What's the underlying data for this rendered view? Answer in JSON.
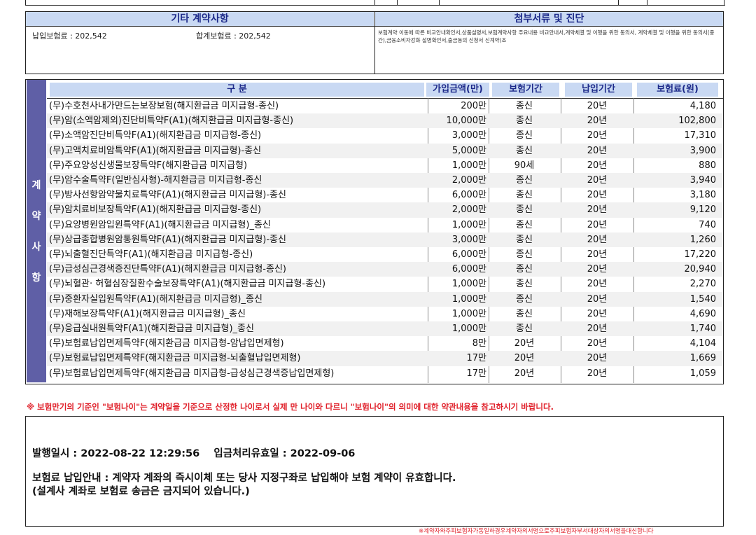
{
  "etc_section": {
    "left_header": "기타 계약사항",
    "right_header": "첨부서류 및 진단",
    "installment_label": "납입보험료 : 202,542",
    "total_label": "합계보험료 : 202,542",
    "docs_text": "보험계약 이동에 따른 비교안내확인서,상품설명서,보험계약사항 주요내용 비교안내서,계약체결 및 이행을 위한 동의서, 계약체결 및 이행을 위한 동의서(중간),금융소비자강화 설명확인서,출금동의 신청서 신계약(조"
  },
  "side_label": [
    "계",
    "약",
    "사",
    "항"
  ],
  "table": {
    "headers": [
      "구 분",
      "가입금액(만)",
      "보험기간",
      "납입기간",
      "보험료(원)"
    ],
    "rows": [
      {
        "name": "(무)수호천사내가만드는보장보험(해지환급금 미지급형-종신)",
        "amount": "200만",
        "period": "종신",
        "pay": "20년",
        "premium": "4,180"
      },
      {
        "name": "(무)암(소액암제외)진단비특약F(A1)(해지환급금 미지급형-종신)",
        "amount": "10,000만",
        "period": "종신",
        "pay": "20년",
        "premium": "102,800"
      },
      {
        "name": "(무)소액암진단비특약F(A1)(해지환급금 미지급형-종신)",
        "amount": "3,000만",
        "period": "종신",
        "pay": "20년",
        "premium": "17,310"
      },
      {
        "name": "(무)고액치료비암특약F(A1)(해지환급금 미지급형)-종신",
        "amount": "5,000만",
        "period": "종신",
        "pay": "20년",
        "premium": "3,900"
      },
      {
        "name": "(무)주요양성신생물보장특약F(해지환급금 미지급형)",
        "amount": "1,000만",
        "period": "90세",
        "pay": "20년",
        "premium": "880"
      },
      {
        "name": "(무)암수술특약F(일반심사형)-해지환급금 미지급형-종신",
        "amount": "2,000만",
        "period": "종신",
        "pay": "20년",
        "premium": "3,940"
      },
      {
        "name": "(무)방사선항암약물치료특약F(A1)(해지환급금 미지급형)-종신",
        "amount": "6,000만",
        "period": "종신",
        "pay": "20년",
        "premium": "3,180"
      },
      {
        "name": "(무)암치료비보장특약F(A1)(해지환급금 미지급형-종신)",
        "amount": "2,000만",
        "period": "종신",
        "pay": "20년",
        "premium": "9,120"
      },
      {
        "name": "(무)요양병원암입원특약F(A1)(해지환급금 미지급형)_종신",
        "amount": "1,000만",
        "period": "종신",
        "pay": "20년",
        "premium": "740"
      },
      {
        "name": "(무)상급종합병원암통원특약F(A1)(해지환급금 미지급형)-종신",
        "amount": "3,000만",
        "period": "종신",
        "pay": "20년",
        "premium": "1,260"
      },
      {
        "name": "(무)뇌출혈진단특약F(A1)(해지환급금 미지급형-종신)",
        "amount": "6,000만",
        "period": "종신",
        "pay": "20년",
        "premium": "17,220"
      },
      {
        "name": "(무)급성심근경색증진단특약F(A1)(해지환급금 미지급형-종신)",
        "amount": "6,000만",
        "period": "종신",
        "pay": "20년",
        "premium": "20,940"
      },
      {
        "name": "(무)뇌혈관· 허혈심장질환수술보장특약F(A1)(해지환급금 미지급형-종신)",
        "amount": "1,000만",
        "period": "종신",
        "pay": "20년",
        "premium": "2,270"
      },
      {
        "name": "(무)중환자실입원특약F(A1)(해지환급금 미지급형)_종신",
        "amount": "1,000만",
        "period": "종신",
        "pay": "20년",
        "premium": "1,540"
      },
      {
        "name": "(무)재해보장특약F(A1)(해지환급금 미지급형)_종신",
        "amount": "1,000만",
        "period": "종신",
        "pay": "20년",
        "premium": "4,690"
      },
      {
        "name": "(무)응급실내원특약F(A1)(해지환급금 미지급형)_종신",
        "amount": "1,000만",
        "period": "종신",
        "pay": "20년",
        "premium": "1,740"
      },
      {
        "name": "(무)보험료납입면제특약F(해지환급금 미지급형-암납입면제형)",
        "amount": "8만",
        "period": "20년",
        "pay": "20년",
        "premium": "4,104"
      },
      {
        "name": "(무)보험료납입면제특약F(해지환급금 미지급형-뇌출혈납입면제형)",
        "amount": "17만",
        "period": "20년",
        "pay": "20년",
        "premium": "1,669"
      },
      {
        "name": "(무)보험료납입면제특약F(해지환급금 미지급형-급성심근경색증납입면제형)",
        "amount": "17만",
        "period": "20년",
        "pay": "20년",
        "premium": "1,059"
      }
    ]
  },
  "notice": "※ 보험만기의 기준인 \"보험나이\"는 계약일을 기준으로 산정한 나이로서 실제 만 나이와 다르니 \"보험나이\"의 의미에 대한 약관내용을 참고하시기 바랍니다.",
  "issue_line": "발행일시 : 2022-08-22 12:29:56    입금처리유효일 : 2022-09-06",
  "payment_line1": "보험료 납입안내 : 계약자 계좌의 즉시이체 또는 당사 지정구좌로 납입해야 보험 계약이 유효합니다.",
  "payment_line2": "(설계사 계좌로 보험료 송금은 금지되어 있습니다.)",
  "footer_note": "※계약자와주피보험자가동일하경우계약자의서명으로주피보험자부서대상자의서명을대신합니다"
}
